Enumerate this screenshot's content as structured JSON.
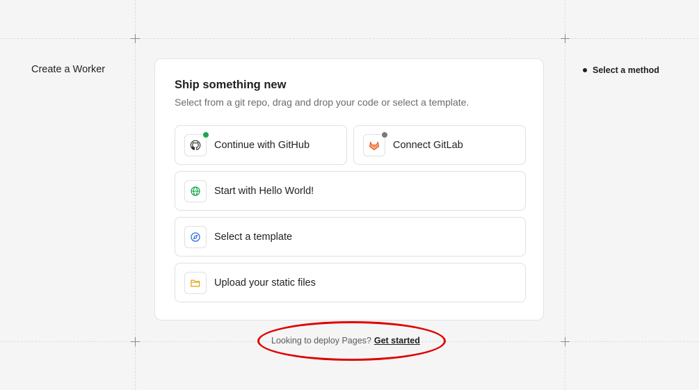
{
  "page": {
    "title": "Create a Worker"
  },
  "steps": {
    "current": "Select a method"
  },
  "card": {
    "title": "Ship something new",
    "subtitle": "Select from a git repo, drag and drop your code or select a template."
  },
  "options": [
    {
      "label": "Continue with GitHub",
      "icon": "github-icon",
      "status_color": "#1aa84f"
    },
    {
      "label": "Connect GitLab",
      "icon": "gitlab-icon",
      "status_color": "#7a7a7a"
    },
    {
      "label": "Start with Hello World!",
      "icon": "globe-icon"
    },
    {
      "label": "Select a template",
      "icon": "compass-icon"
    },
    {
      "label": "Upload your static files",
      "icon": "folder-icon"
    }
  ],
  "footer": {
    "text": "Looking to deploy Pages?",
    "link": "Get started"
  },
  "colors": {
    "background": "#f5f5f5",
    "annotation": "#e00000",
    "github_status": "#1aa84f",
    "gitlab_orange": "#e8622c",
    "globe_green": "#1aa84f",
    "compass_blue": "#2f6fe0",
    "folder_yellow": "#e3a61a"
  }
}
